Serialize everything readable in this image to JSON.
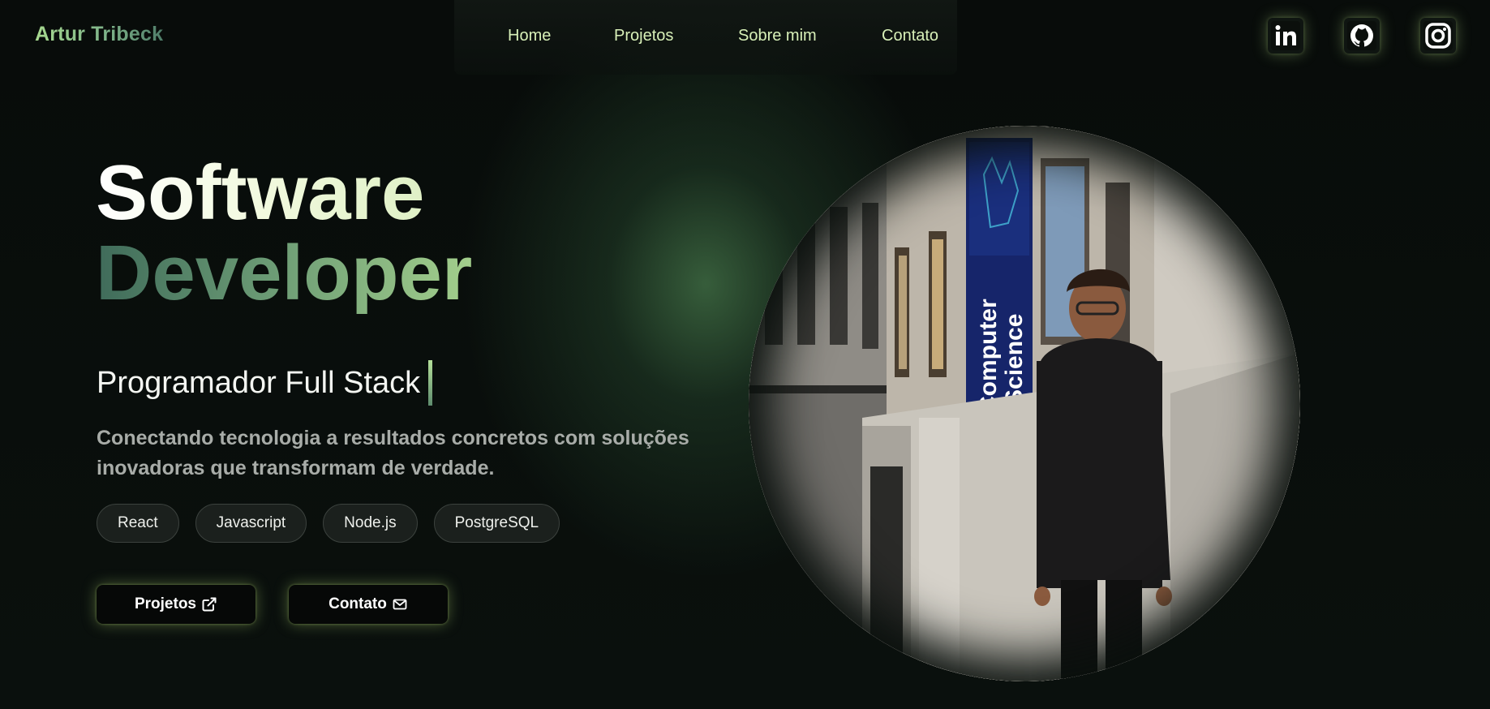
{
  "header": {
    "brand": "Artur Tribeck",
    "nav": [
      {
        "label": "Home"
      },
      {
        "label": "Projetos"
      },
      {
        "label": "Sobre mim"
      },
      {
        "label": "Contato"
      }
    ],
    "social": [
      {
        "icon": "linkedin-icon"
      },
      {
        "icon": "github-icon"
      },
      {
        "icon": "instagram-icon"
      }
    ]
  },
  "hero": {
    "title_line1": "Software",
    "title_line2": "Developer",
    "subtitle": "Programador Full Stack",
    "description": "Conectando tecnologia a resultados concretos com soluções inovadoras que transformam de verdade.",
    "skills": [
      "React",
      "Javascript",
      "Node.js",
      "PostgreSQL"
    ],
    "buttons": {
      "projects_label": "Projetos",
      "projects_icon": "external-link-icon",
      "contact_label": "Contato",
      "contact_icon": "mail-icon"
    }
  },
  "photo": {
    "banner_text_line1": "Computer",
    "banner_text_line2": "Science"
  },
  "colors": {
    "background": "#070b09",
    "accent_light": "#a7d98f",
    "accent_dark": "#3f6b5a",
    "nav_text": "#d8f0b8"
  }
}
